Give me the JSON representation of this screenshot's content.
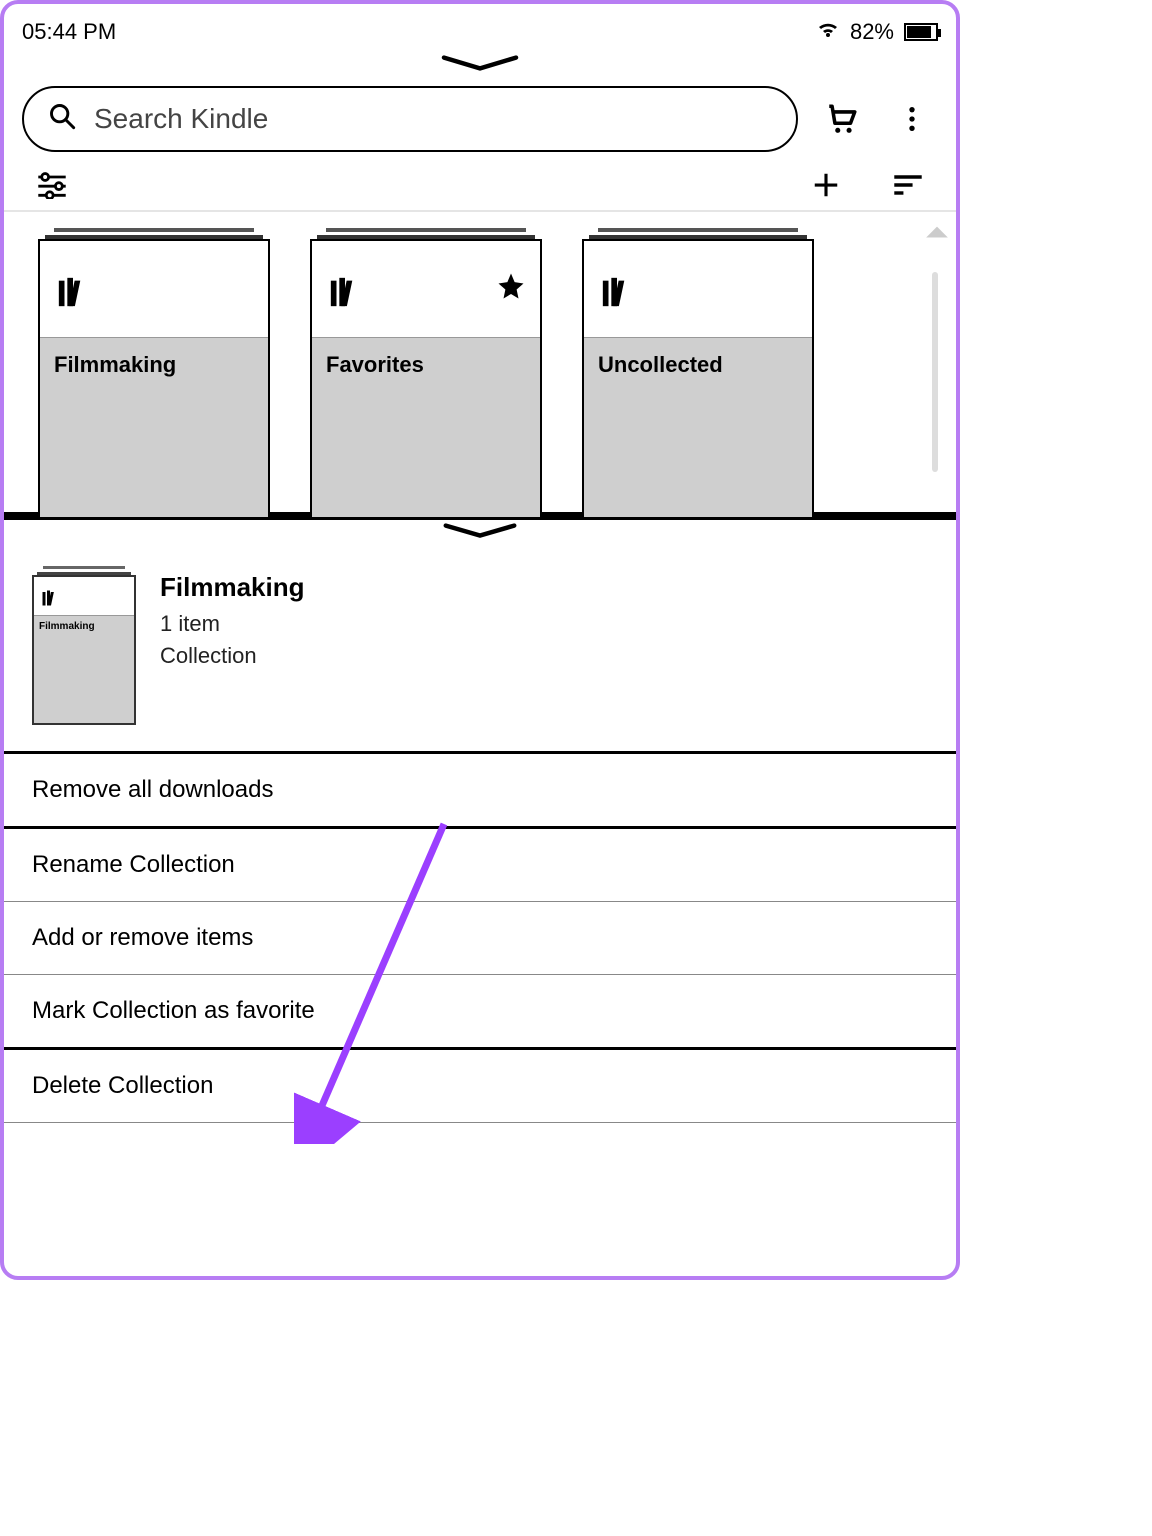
{
  "statusbar": {
    "time": "05:44 PM",
    "battery": "82%"
  },
  "search": {
    "placeholder": "Search Kindle"
  },
  "collections": [
    {
      "name": "Filmmaking",
      "starred": false
    },
    {
      "name": "Favorites",
      "starred": true
    },
    {
      "name": "Uncollected",
      "starred": false
    }
  ],
  "detail": {
    "title": "Filmmaking",
    "count_line": "1 item",
    "type_line": "Collection",
    "thumbnail_label": "Filmmaking"
  },
  "menu": {
    "remove_downloads": "Remove all downloads",
    "rename": "Rename Collection",
    "add_remove": "Add or remove items",
    "mark_favorite": "Mark Collection as favorite",
    "delete": "Delete Collection"
  }
}
